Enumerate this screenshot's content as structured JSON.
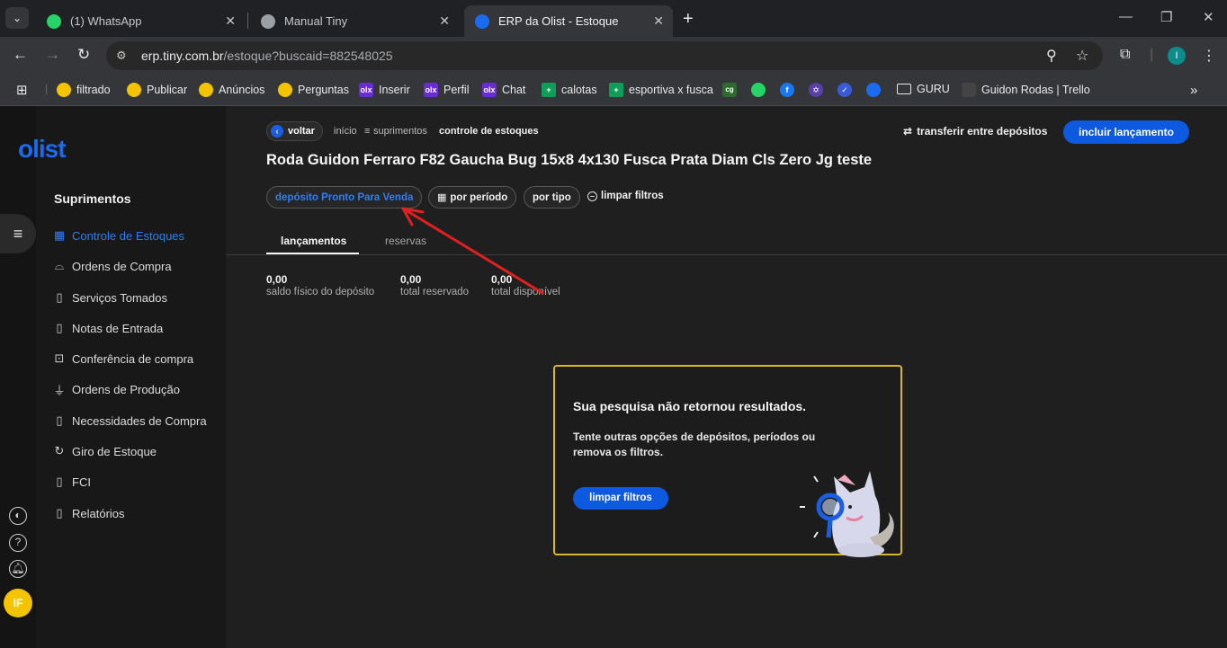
{
  "browser": {
    "tabs": [
      {
        "title": "(1) WhatsApp",
        "color": "#25d366"
      },
      {
        "title": "Manual Tiny",
        "color": "#9aa0a6"
      },
      {
        "title": "ERP da Olist - Estoque",
        "color": "#1b6bf0"
      }
    ],
    "url_host": "erp.tiny.com.br",
    "url_path": "/estoque?buscaid=882548025",
    "profile_initial": "I"
  },
  "bookmarks": [
    {
      "label": "filtrado",
      "color": "#f5c400"
    },
    {
      "label": "Publicar",
      "color": "#f5c400"
    },
    {
      "label": "Anúncios",
      "color": "#f5c400"
    },
    {
      "label": "Perguntas",
      "color": "#f5c400"
    },
    {
      "label": "Inserir",
      "color": "#6c2bd9",
      "glyph": "olx"
    },
    {
      "label": "Perfil",
      "color": "#6c2bd9",
      "glyph": "olx"
    },
    {
      "label": "Chat",
      "color": "#6c2bd9",
      "glyph": "olx"
    },
    {
      "label": "calotas",
      "color": "#0f9d58",
      "glyph": "+"
    },
    {
      "label": "esportiva x fusca",
      "color": "#0f9d58",
      "glyph": "+"
    },
    {
      "label": "GURU",
      "color": "transparent"
    },
    {
      "label": "Guidon Rodas | Trello",
      "color": "#444"
    }
  ],
  "sidebar": {
    "logo": "olist",
    "section_title": "Suprimentos",
    "items": [
      {
        "label": "Controle de Estoques",
        "icon": "grid-icon",
        "glyph": "▦"
      },
      {
        "label": "Ordens de Compra",
        "icon": "inbox-icon",
        "glyph": "⌓"
      },
      {
        "label": "Serviços Tomados",
        "icon": "document-icon",
        "glyph": "▯"
      },
      {
        "label": "Notas de Entrada",
        "icon": "document-icon",
        "glyph": "▯"
      },
      {
        "label": "Conferência de compra",
        "icon": "box-icon",
        "glyph": "⊡"
      },
      {
        "label": "Ordens de Produção",
        "icon": "plug-icon",
        "glyph": "⏚"
      },
      {
        "label": "Necessidades de Compra",
        "icon": "clipboard-icon",
        "glyph": "▯"
      },
      {
        "label": "Giro de Estoque",
        "icon": "refresh-icon",
        "glyph": "↻"
      },
      {
        "label": "FCI",
        "icon": "document-icon",
        "glyph": "▯"
      },
      {
        "label": "Relatórios",
        "icon": "report-icon",
        "glyph": "▯"
      }
    ],
    "avatar_initials": "IF"
  },
  "header": {
    "back_label": "voltar",
    "breadcrumb": [
      "início",
      "suprimentos",
      "controle de estoques"
    ],
    "transfer_label": "transferir entre depósitos",
    "include_label": "incluir lançamento"
  },
  "product": {
    "title": "Roda Guidon Ferraro F82 Gaucha Bug 15x8 4x130 Fusca Prata Diam Cls Zero Jg teste"
  },
  "filters": {
    "deposit": "depósito Pronto Para Venda",
    "period": "por período",
    "type": "por tipo",
    "clear": "limpar filtros"
  },
  "tabs": [
    "lançamentos",
    "reservas"
  ],
  "stats": [
    {
      "value": "0,00",
      "label": "saldo físico do depósito"
    },
    {
      "value": "0,00",
      "label": "total reservado"
    },
    {
      "value": "0,00",
      "label": "total disponível"
    }
  ],
  "empty_state": {
    "title": "Sua pesquisa não retornou resultados.",
    "text": "Tente outras opções de depósitos, períodos ou remova os filtros.",
    "button": "limpar filtros"
  },
  "colors": {
    "accent": "#0d5ae0",
    "highlight_border": "#d9b62e",
    "annotation_arrow": "#e02020"
  }
}
